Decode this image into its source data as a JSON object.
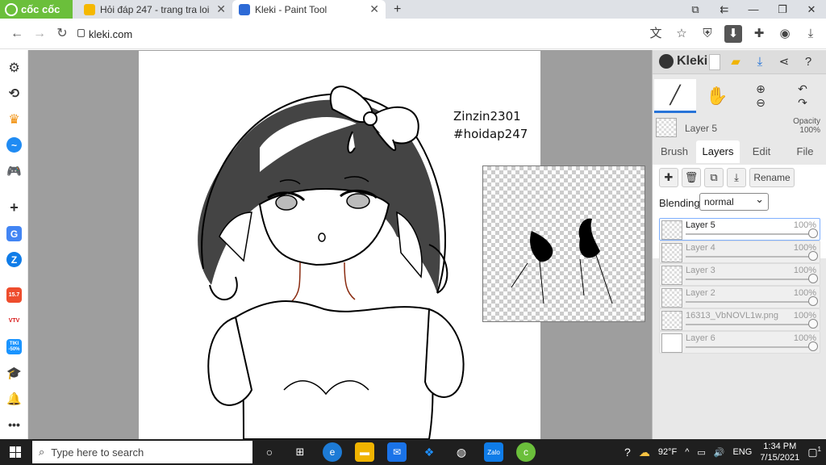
{
  "browser": {
    "brand": "cốc cốc",
    "tabs": [
      {
        "title": "Hỏi đáp 247 - trang tra loi",
        "active": false
      },
      {
        "title": "Kleki - Paint Tool",
        "active": true
      }
    ],
    "new_tab": "+",
    "url": "kleki.com"
  },
  "canvas": {
    "watermark_line1": "Zinzin2301",
    "watermark_line2": "#hoidap247"
  },
  "kleki": {
    "logo": "Kleki",
    "current_layer": "Layer 5",
    "opacity_label": "Opacity",
    "opacity_value": "100%",
    "tabs": [
      "Brush",
      "Layers",
      "Edit",
      "File"
    ],
    "active_tab": "Layers",
    "rename_label": "Rename",
    "blending_label": "Blending",
    "blending_value": "normal",
    "layers": [
      {
        "name": "Layer 5",
        "opacity": "100%",
        "active": true
      },
      {
        "name": "Layer 4",
        "opacity": "100%",
        "active": false
      },
      {
        "name": "Layer 3",
        "opacity": "100%",
        "active": false
      },
      {
        "name": "Layer 2",
        "opacity": "100%",
        "active": false
      },
      {
        "name": "16313_VbNOVL1w.png",
        "opacity": "100%",
        "active": false
      },
      {
        "name": "Layer 6",
        "opacity": "100%",
        "active": false
      }
    ]
  },
  "taskbar": {
    "search_placeholder": "Type here to search",
    "weather": "92°F",
    "language": "ENG",
    "time": "1:34 PM",
    "date": "7/15/2021",
    "notification_count": "1"
  },
  "sidebar_badges": {
    "shopee": "15.7",
    "vtv": "VTV",
    "tiki": "TIKI -50%"
  }
}
